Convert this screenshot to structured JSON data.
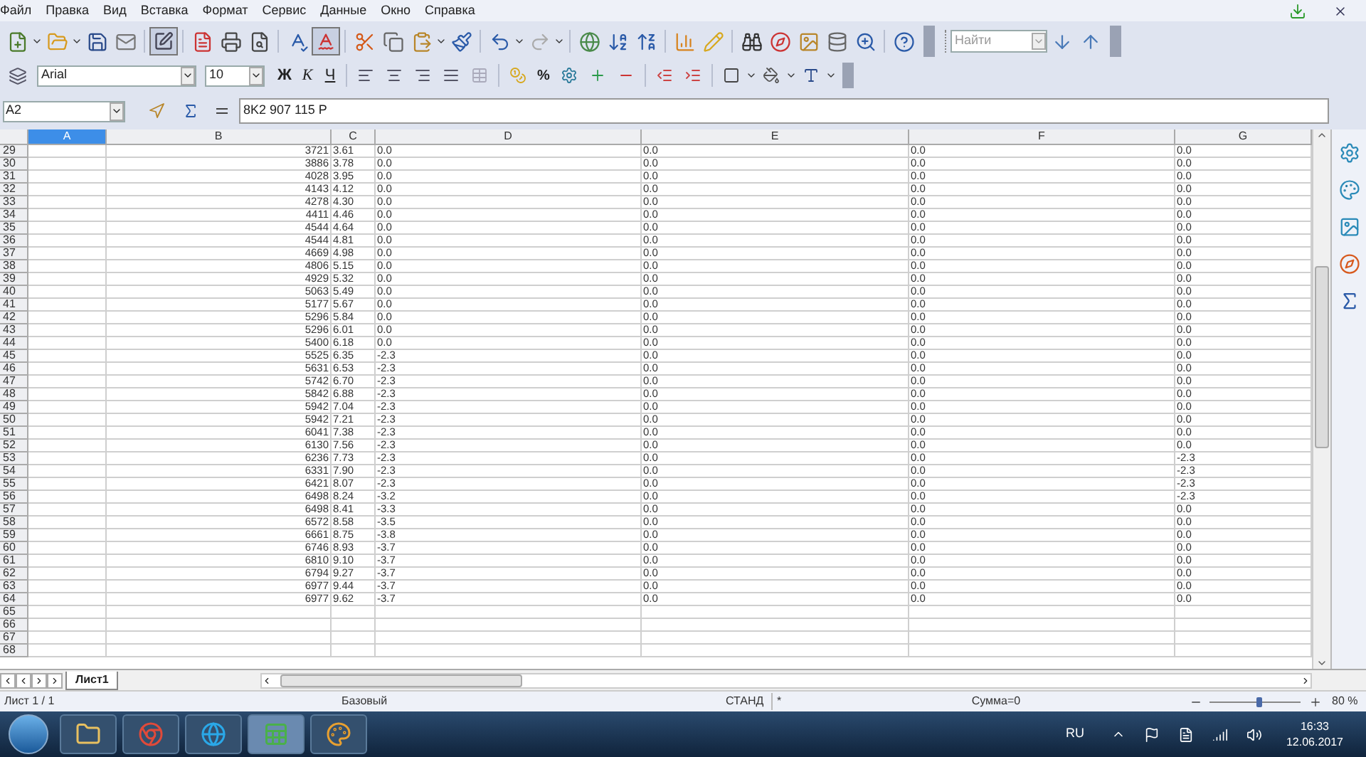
{
  "menu": [
    "Файл",
    "Правка",
    "Вид",
    "Вставка",
    "Формат",
    "Сервис",
    "Данные",
    "Окно",
    "Справка"
  ],
  "toolbar": {
    "find": {
      "placeholder": "Найти"
    }
  },
  "format_bar": {
    "font": "Arial",
    "size": "10",
    "style_buttons": [
      "Ж",
      "К",
      "Ч"
    ],
    "percent": "%"
  },
  "formula_bar": {
    "name_box": "A2",
    "content": "8K2 907 115 P"
  },
  "columns": [
    {
      "label": "A",
      "selected": true
    },
    {
      "label": "B",
      "selected": false
    },
    {
      "label": "C",
      "selected": false
    },
    {
      "label": "D",
      "selected": false
    },
    {
      "label": "E",
      "selected": false
    },
    {
      "label": "F",
      "selected": false
    },
    {
      "label": "G",
      "selected": false
    }
  ],
  "rows": [
    {
      "row": "29",
      "b": "3721",
      "c": "3.61",
      "d": "0.0",
      "e": "0.0",
      "f": "0.0",
      "g": "0.0"
    },
    {
      "row": "30",
      "b": "3886",
      "c": "3.78",
      "d": "0.0",
      "e": "0.0",
      "f": "0.0",
      "g": "0.0"
    },
    {
      "row": "31",
      "b": "4028",
      "c": "3.95",
      "d": "0.0",
      "e": "0.0",
      "f": "0.0",
      "g": "0.0"
    },
    {
      "row": "32",
      "b": "4143",
      "c": "4.12",
      "d": "0.0",
      "e": "0.0",
      "f": "0.0",
      "g": "0.0"
    },
    {
      "row": "33",
      "b": "4278",
      "c": "4.30",
      "d": "0.0",
      "e": "0.0",
      "f": "0.0",
      "g": "0.0"
    },
    {
      "row": "34",
      "b": "4411",
      "c": "4.46",
      "d": "0.0",
      "e": "0.0",
      "f": "0.0",
      "g": "0.0"
    },
    {
      "row": "35",
      "b": "4544",
      "c": "4.64",
      "d": "0.0",
      "e": "0.0",
      "f": "0.0",
      "g": "0.0"
    },
    {
      "row": "36",
      "b": "4544",
      "c": "4.81",
      "d": "0.0",
      "e": "0.0",
      "f": "0.0",
      "g": "0.0"
    },
    {
      "row": "37",
      "b": "4669",
      "c": "4.98",
      "d": "0.0",
      "e": "0.0",
      "f": "0.0",
      "g": "0.0"
    },
    {
      "row": "38",
      "b": "4806",
      "c": "5.15",
      "d": "0.0",
      "e": "0.0",
      "f": "0.0",
      "g": "0.0"
    },
    {
      "row": "39",
      "b": "4929",
      "c": "5.32",
      "d": "0.0",
      "e": "0.0",
      "f": "0.0",
      "g": "0.0"
    },
    {
      "row": "40",
      "b": "5063",
      "c": "5.49",
      "d": "0.0",
      "e": "0.0",
      "f": "0.0",
      "g": "0.0"
    },
    {
      "row": "41",
      "b": "5177",
      "c": "5.67",
      "d": "0.0",
      "e": "0.0",
      "f": "0.0",
      "g": "0.0"
    },
    {
      "row": "42",
      "b": "5296",
      "c": "5.84",
      "d": "0.0",
      "e": "0.0",
      "f": "0.0",
      "g": "0.0"
    },
    {
      "row": "43",
      "b": "5296",
      "c": "6.01",
      "d": "0.0",
      "e": "0.0",
      "f": "0.0",
      "g": "0.0"
    },
    {
      "row": "44",
      "b": "5400",
      "c": "6.18",
      "d": "0.0",
      "e": "0.0",
      "f": "0.0",
      "g": "0.0"
    },
    {
      "row": "45",
      "b": "5525",
      "c": "6.35",
      "d": "-2.3",
      "e": "0.0",
      "f": "0.0",
      "g": "0.0"
    },
    {
      "row": "46",
      "b": "5631",
      "c": "6.53",
      "d": "-2.3",
      "e": "0.0",
      "f": "0.0",
      "g": "0.0"
    },
    {
      "row": "47",
      "b": "5742",
      "c": "6.70",
      "d": "-2.3",
      "e": "0.0",
      "f": "0.0",
      "g": "0.0"
    },
    {
      "row": "48",
      "b": "5842",
      "c": "6.88",
      "d": "-2.3",
      "e": "0.0",
      "f": "0.0",
      "g": "0.0"
    },
    {
      "row": "49",
      "b": "5942",
      "c": "7.04",
      "d": "-2.3",
      "e": "0.0",
      "f": "0.0",
      "g": "0.0"
    },
    {
      "row": "50",
      "b": "5942",
      "c": "7.21",
      "d": "-2.3",
      "e": "0.0",
      "f": "0.0",
      "g": "0.0"
    },
    {
      "row": "51",
      "b": "6041",
      "c": "7.38",
      "d": "-2.3",
      "e": "0.0",
      "f": "0.0",
      "g": "0.0"
    },
    {
      "row": "52",
      "b": "6130",
      "c": "7.56",
      "d": "-2.3",
      "e": "0.0",
      "f": "0.0",
      "g": "0.0"
    },
    {
      "row": "53",
      "b": "6236",
      "c": "7.73",
      "d": "-2.3",
      "e": "0.0",
      "f": "0.0",
      "g": "-2.3"
    },
    {
      "row": "54",
      "b": "6331",
      "c": "7.90",
      "d": "-2.3",
      "e": "0.0",
      "f": "0.0",
      "g": "-2.3"
    },
    {
      "row": "55",
      "b": "6421",
      "c": "8.07",
      "d": "-2.3",
      "e": "0.0",
      "f": "0.0",
      "g": "-2.3"
    },
    {
      "row": "56",
      "b": "6498",
      "c": "8.24",
      "d": "-3.2",
      "e": "0.0",
      "f": "0.0",
      "g": "-2.3"
    },
    {
      "row": "57",
      "b": "6498",
      "c": "8.41",
      "d": "-3.3",
      "e": "0.0",
      "f": "0.0",
      "g": "0.0"
    },
    {
      "row": "58",
      "b": "6572",
      "c": "8.58",
      "d": "-3.5",
      "e": "0.0",
      "f": "0.0",
      "g": "0.0"
    },
    {
      "row": "59",
      "b": "6661",
      "c": "8.75",
      "d": "-3.8",
      "e": "0.0",
      "f": "0.0",
      "g": "0.0"
    },
    {
      "row": "60",
      "b": "6746",
      "c": "8.93",
      "d": "-3.7",
      "e": "0.0",
      "f": "0.0",
      "g": "0.0"
    },
    {
      "row": "61",
      "b": "6810",
      "c": "9.10",
      "d": "-3.7",
      "e": "0.0",
      "f": "0.0",
      "g": "0.0"
    },
    {
      "row": "62",
      "b": "6794",
      "c": "9.27",
      "d": "-3.7",
      "e": "0.0",
      "f": "0.0",
      "g": "0.0"
    },
    {
      "row": "63",
      "b": "6977",
      "c": "9.44",
      "d": "-3.7",
      "e": "0.0",
      "f": "0.0",
      "g": "0.0"
    },
    {
      "row": "64",
      "b": "6977",
      "c": "9.62",
      "d": "-3.7",
      "e": "0.0",
      "f": "0.0",
      "g": "0.0"
    },
    {
      "row": "65"
    },
    {
      "row": "66"
    },
    {
      "row": "67"
    },
    {
      "row": "68"
    }
  ],
  "sheet_tabs": [
    {
      "label": "Лист1",
      "selected": true
    }
  ],
  "status_bar": {
    "sheet": "Лист 1 / 1",
    "style": "Базовый",
    "mode": "СТАНД",
    "modified": "*",
    "sum": "Сумма=0",
    "zoom": {
      "level": 0.55,
      "reading": "80 %"
    }
  },
  "taskbar": {
    "language": "RU",
    "time": "16:33",
    "date": "12.06.2017"
  }
}
